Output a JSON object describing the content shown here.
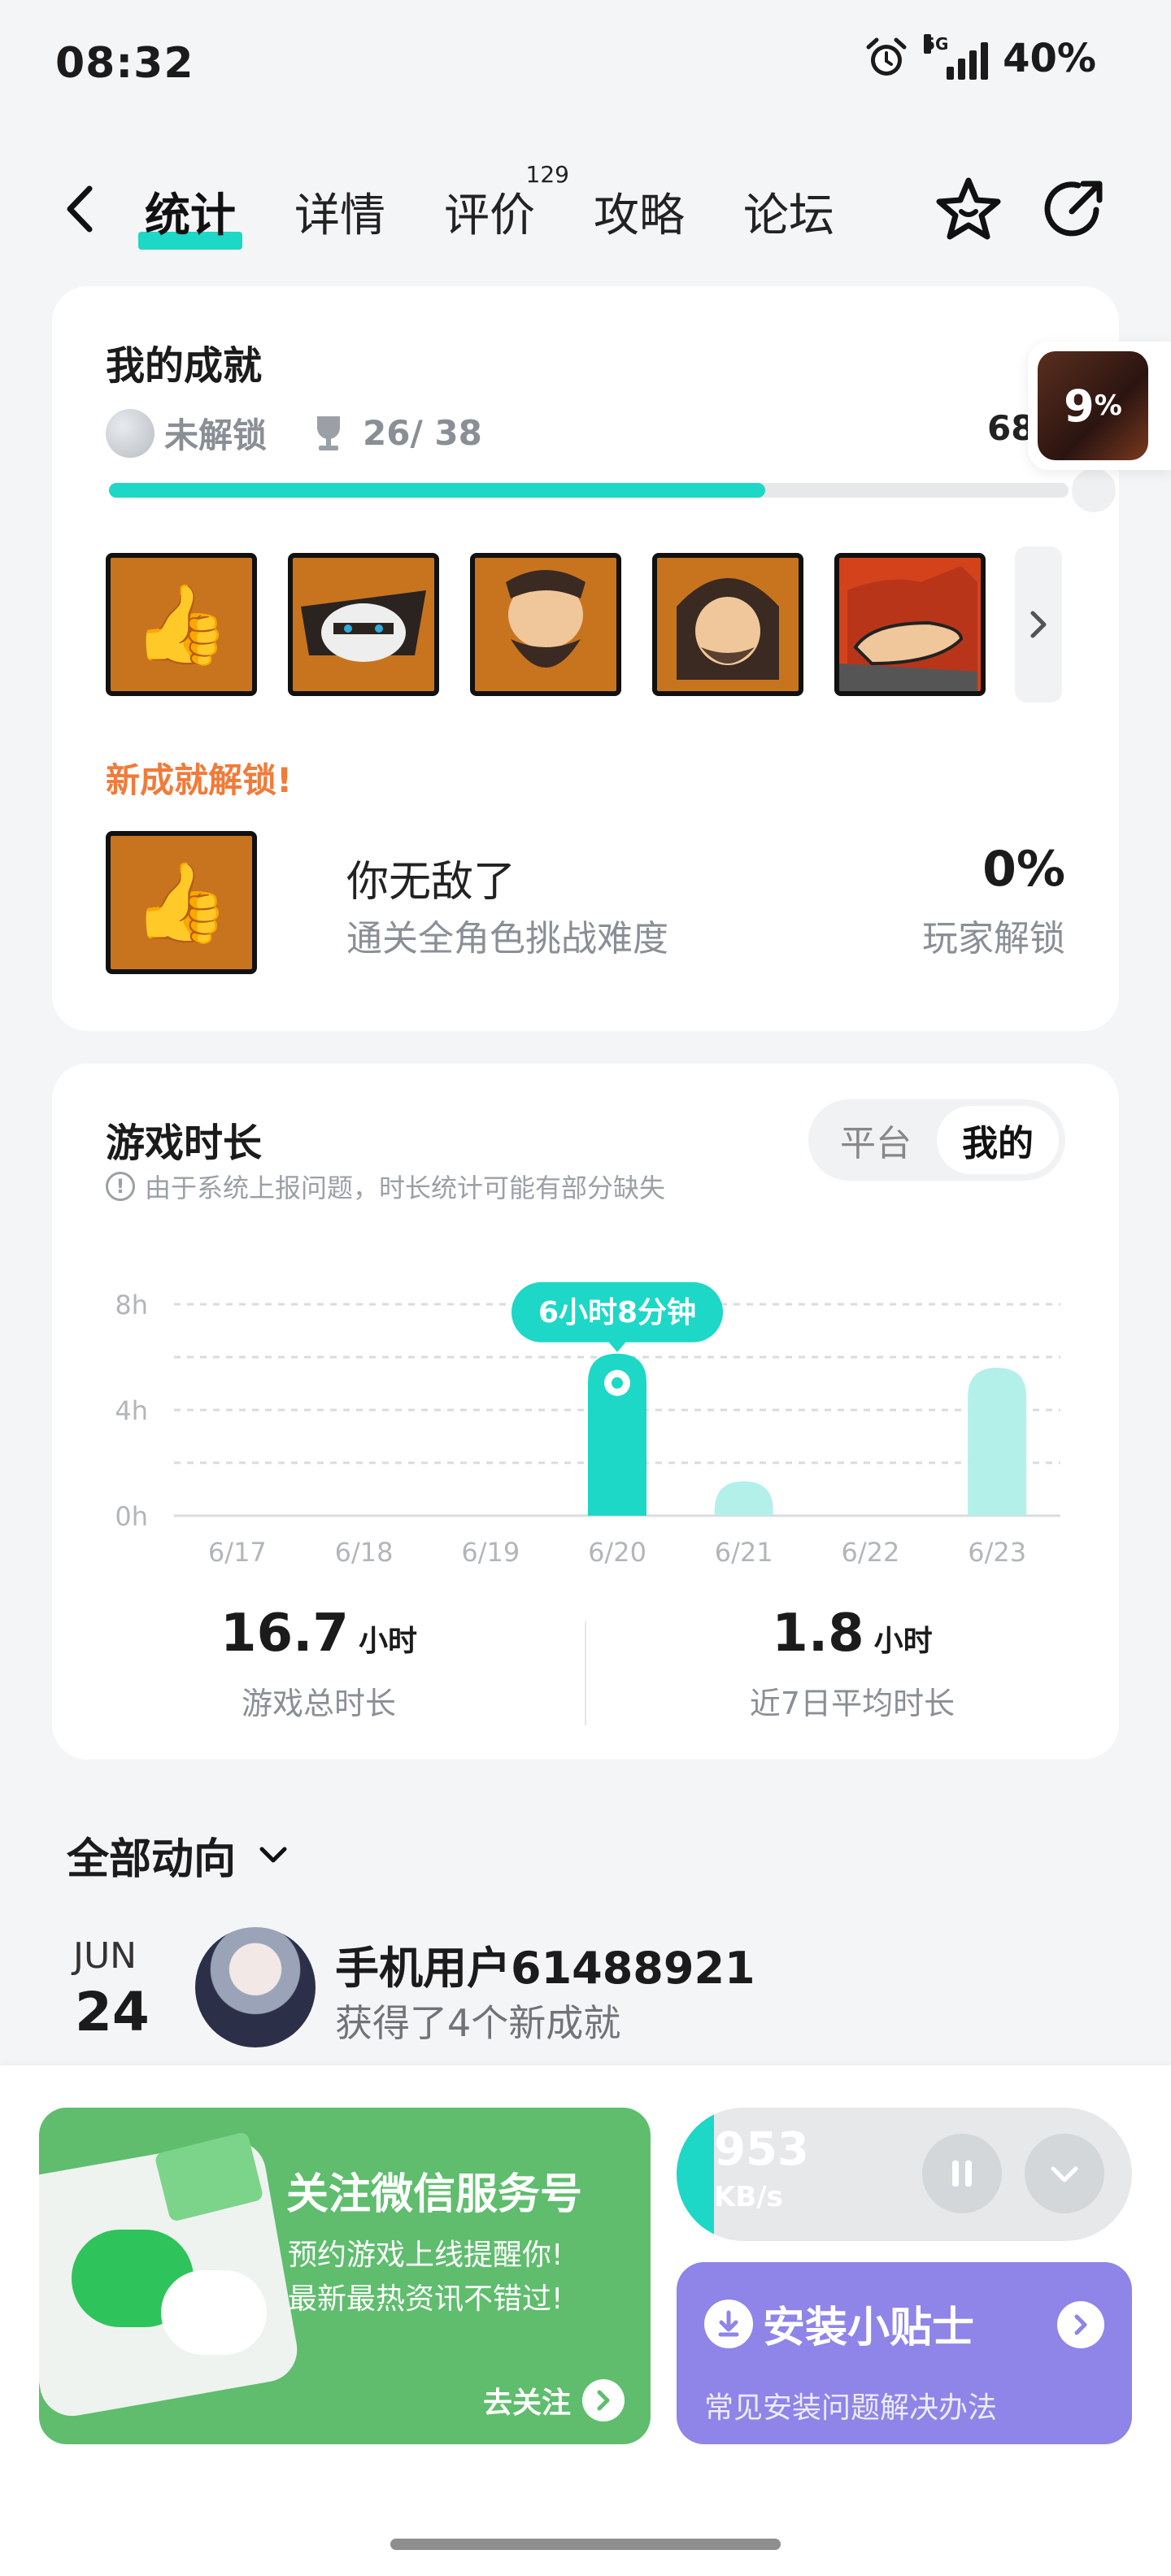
{
  "status": {
    "time": "08:32",
    "network": "5G",
    "battery": "40%"
  },
  "nav": {
    "tabs": [
      {
        "label": "统计",
        "active": true
      },
      {
        "label": "详情"
      },
      {
        "label": "评价",
        "badge": "129"
      },
      {
        "label": "攻略"
      },
      {
        "label": "论坛"
      }
    ]
  },
  "achievements": {
    "title": "我的成就",
    "locked_label": "未解锁",
    "progress_text": "26/ 38",
    "rate_label": "68",
    "progress_fraction": 0.684,
    "icons": [
      "thumbs-up-icon",
      "masked-bandit-icon",
      "bearded-warrior-icon",
      "old-sage-icon",
      "hand-icon"
    ],
    "new_unlock_label": "新成就解锁!",
    "new": {
      "name": "你无敌了",
      "desc": "通关全角色挑战难度",
      "pct": "0%",
      "pct_label": "玩家解锁"
    },
    "floating_pct": "9",
    "floating_pct_sign": "%"
  },
  "playtime": {
    "title": "游戏时长",
    "note": "由于系统上报问题，时长统计可能有部分缺失",
    "segment": {
      "platform": "平台",
      "mine": "我的"
    },
    "summary": [
      {
        "value": "16.7",
        "unit": "小时",
        "label": "游戏总时长"
      },
      {
        "value": "1.8",
        "unit": "小时",
        "label": "近7日平均时长"
      }
    ]
  },
  "chart_data": {
    "type": "bar",
    "categories": [
      "6/17",
      "6/18",
      "6/19",
      "6/20",
      "6/21",
      "6/22",
      "6/23"
    ],
    "values": [
      0,
      0,
      0,
      6.13,
      1.3,
      0,
      5.6
    ],
    "ylim": [
      0,
      8
    ],
    "yticks": [
      "0h",
      "4h",
      "8h"
    ],
    "ytick_values": [
      0,
      4,
      8
    ],
    "highlight_index": 3,
    "highlight_label": "6小时8分钟",
    "grid": true,
    "colors": {
      "highlight": "#1dd7c7",
      "normal": "#b3f0ea"
    }
  },
  "feed": {
    "title": "全部动向",
    "items": [
      {
        "month": "JUN",
        "day": "24",
        "user": "手机用户61488921",
        "text": "获得了4个新成就"
      }
    ]
  },
  "promo": {
    "wechat": {
      "title": "关注微信服务号",
      "line1": "预约游戏上线提醒你!",
      "line2": "最新最热资讯不错过!",
      "cta": "去关注"
    },
    "download": {
      "speed": "953",
      "unit": "KB/s"
    },
    "tips": {
      "title": "安装小贴士",
      "sub": "常见安装问题解决办法"
    }
  }
}
